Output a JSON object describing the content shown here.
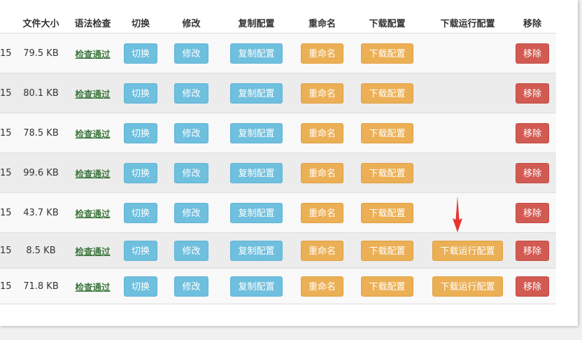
{
  "table": {
    "headers": {
      "size": "文件大小",
      "syntax": "语法检查",
      "switch": "切换",
      "modify": "修改",
      "copy": "复制配置",
      "rename": "重命名",
      "download": "下载配置",
      "download_running": "下载运行配置",
      "remove": "移除"
    },
    "rows": [
      {
        "date_fragment": "15",
        "size": "79.5 KB",
        "syntax": "检查通过",
        "switch": "切换",
        "modify": "修改",
        "copy": "复制配置",
        "rename": "重命名",
        "download": "下载配置",
        "download_running": "",
        "remove": "移除"
      },
      {
        "date_fragment": "15",
        "size": "80.1 KB",
        "syntax": "检查通过",
        "switch": "切换",
        "modify": "修改",
        "copy": "复制配置",
        "rename": "重命名",
        "download": "下载配置",
        "download_running": "",
        "remove": "移除"
      },
      {
        "date_fragment": "15",
        "size": "78.5 KB",
        "syntax": "检查通过",
        "switch": "切换",
        "modify": "修改",
        "copy": "复制配置",
        "rename": "重命名",
        "download": "下载配置",
        "download_running": "",
        "remove": "移除"
      },
      {
        "date_fragment": "15",
        "size": "99.6 KB",
        "syntax": "检查通过",
        "switch": "切换",
        "modify": "修改",
        "copy": "复制配置",
        "rename": "重命名",
        "download": "下载配置",
        "download_running": "",
        "remove": "移除"
      },
      {
        "date_fragment": "15",
        "size": "43.7 KB",
        "syntax": "检查通过",
        "switch": "切换",
        "modify": "修改",
        "copy": "复制配置",
        "rename": "重命名",
        "download": "下载配置",
        "download_running": "",
        "remove": "移除"
      },
      {
        "date_fragment": "15",
        "size": "8.5 KB",
        "syntax": "检查通过",
        "switch": "切换",
        "modify": "修改",
        "copy": "复制配置",
        "rename": "重命名",
        "download": "下载配置",
        "download_running": "下载运行配置",
        "remove": "移除"
      },
      {
        "date_fragment": "15",
        "size": "71.8 KB",
        "syntax": "检查通过",
        "switch": "切换",
        "modify": "修改",
        "copy": "复制配置",
        "rename": "重命名",
        "download": "下载配置",
        "download_running": "下载运行配置",
        "remove": "移除"
      }
    ]
  },
  "colors": {
    "info": "#6fbfde",
    "warning": "#ebaf55",
    "danger": "#d15b52",
    "pass_text": "#3c763d",
    "annotation_arrow": "#e8332e"
  },
  "annotation": {
    "icon": "red-down-arrow"
  }
}
